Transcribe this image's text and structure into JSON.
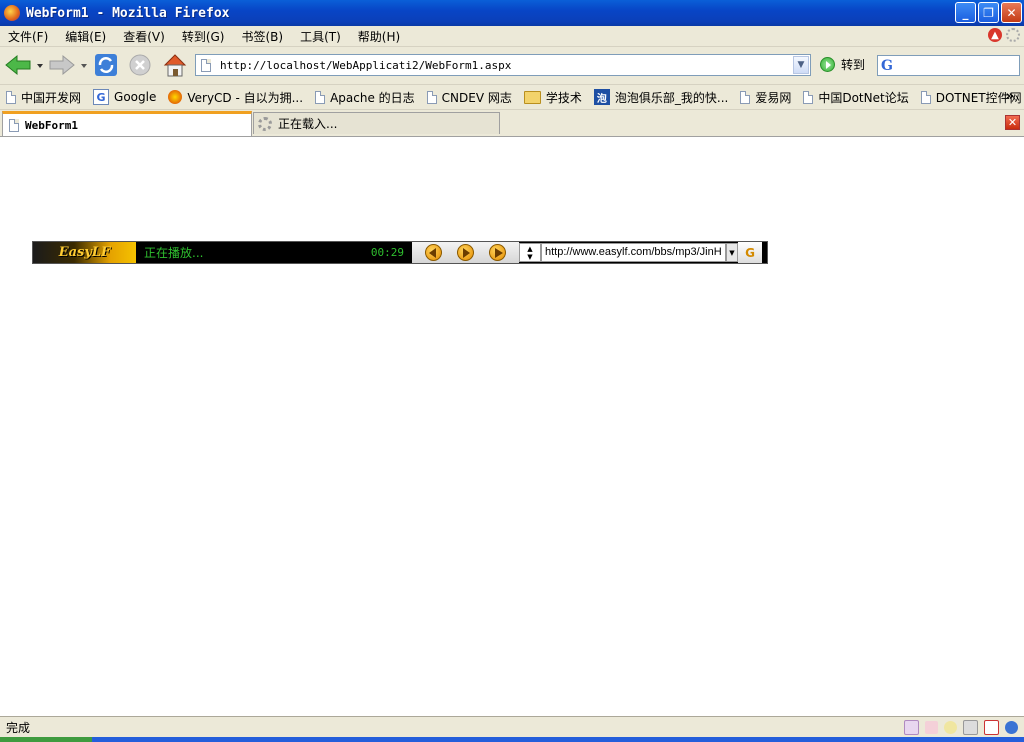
{
  "window": {
    "title": "WebForm1 - Mozilla Firefox",
    "buttons": {
      "minimize": "_",
      "maximize": "❐",
      "close": "✕"
    }
  },
  "menu": {
    "items": [
      "文件(F)",
      "编辑(E)",
      "查看(V)",
      "转到(G)",
      "书签(B)",
      "工具(T)",
      "帮助(H)"
    ]
  },
  "navigation": {
    "url": "http://localhost/WebApplicati2/WebForm1.aspx",
    "go_label": "转到",
    "search_engine_letter": "G"
  },
  "bookmarks": {
    "items": [
      {
        "label": "中国开发网",
        "icon": "page-icon"
      },
      {
        "label": "Google",
        "icon": "google-icon"
      },
      {
        "label": "VeryCD - 自以为拥...",
        "icon": "verycd-icon"
      },
      {
        "label": "Apache 的日志",
        "icon": "page-icon"
      },
      {
        "label": "CNDEV 网志",
        "icon": "page-icon"
      },
      {
        "label": "学技术",
        "icon": "folder-icon"
      },
      {
        "label": "泡泡俱乐部_我的快...",
        "icon": "paopao-icon"
      },
      {
        "label": "爱易网",
        "icon": "page-icon"
      },
      {
        "label": "中国DotNet论坛",
        "icon": "page-icon"
      },
      {
        "label": "DOTNET控件网",
        "icon": "page-icon"
      }
    ],
    "more": "»"
  },
  "tabs": [
    {
      "label": "WebForm1",
      "active": true
    },
    {
      "label": "正在载入...",
      "active": false
    }
  ],
  "player": {
    "logo_text": "EasyLF",
    "status": "正在播放...",
    "time": "00:29",
    "url": "http://www.easylf.com/bbs/mp3/JinH",
    "end_logo": "G"
  },
  "status_bar": {
    "text": "完成"
  },
  "colors": {
    "titlebar": "#0845c6",
    "player_text": "#2fbf2f",
    "active_tab_accent": "#f0a020"
  }
}
